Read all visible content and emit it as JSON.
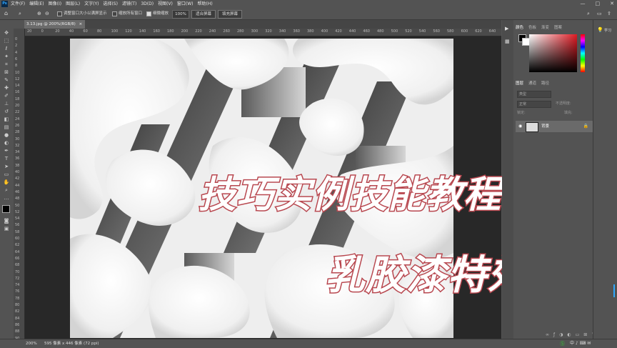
{
  "menubar": {
    "app_logo": "Ps",
    "items": [
      "文件(F)",
      "编辑(E)",
      "图像(I)",
      "图层(L)",
      "文字(Y)",
      "选择(S)",
      "滤镜(T)",
      "3D(D)",
      "视图(V)",
      "窗口(W)",
      "帮助(H)"
    ],
    "window_controls": [
      "—",
      "□",
      "✕"
    ]
  },
  "options": {
    "resize_windows_label": "调整窗口大小以满屏显示",
    "zoom_all_label": "缩放所有窗口",
    "scrubby_zoom_label": "细微缩放",
    "zoom_value": "100%",
    "fit_screen_label": "适合屏幕",
    "fill_screen_label": "填充屏幕"
  },
  "document": {
    "tab_title": "3.13.jpg @ 200%(RGB/8)",
    "tab_close": "×"
  },
  "ruler": {
    "top_labels": [
      "20",
      "0",
      "20",
      "40",
      "60",
      "80",
      "100",
      "120",
      "140",
      "160",
      "180",
      "200",
      "220",
      "240",
      "260",
      "280",
      "300",
      "320",
      "340",
      "360",
      "380",
      "400",
      "420",
      "440",
      "460",
      "480",
      "500",
      "520",
      "540",
      "560",
      "580",
      "600",
      "620",
      "640"
    ],
    "left_labels": [
      "0",
      "2",
      "4",
      "6",
      "8",
      "10",
      "12",
      "14",
      "16",
      "18",
      "20",
      "22",
      "24",
      "26",
      "28",
      "30",
      "32",
      "34",
      "36",
      "38",
      "40",
      "42",
      "44",
      "46",
      "48",
      "50",
      "52",
      "54",
      "56",
      "58",
      "60",
      "62",
      "64",
      "66",
      "68",
      "70",
      "72",
      "74",
      "76",
      "78",
      "80",
      "82",
      "84",
      "86",
      "88",
      "90"
    ]
  },
  "status": {
    "zoom": "200%",
    "doc_info": "595 像素 x 446 像素 (72 ppi)"
  },
  "panels": {
    "color_tabs": [
      "颜色",
      "色板",
      "渐变",
      "图案"
    ],
    "layer_tabs": [
      "图层",
      "通道",
      "路径"
    ],
    "kind_placeholder": "类型",
    "blend_mode": "正常",
    "opacity_label": "不透明度:",
    "lock_label": "锁定:",
    "fill_label": "填充:",
    "layer_name": "背景",
    "learn_label": "学习"
  },
  "overlay": {
    "title_line1": "技巧实例技能教程",
    "title_line2": "乳胶漆特效"
  },
  "colors": {
    "title_stroke": "#b8474f",
    "title_fill": "#ffffff",
    "accent_blue": "#31a8ff"
  }
}
